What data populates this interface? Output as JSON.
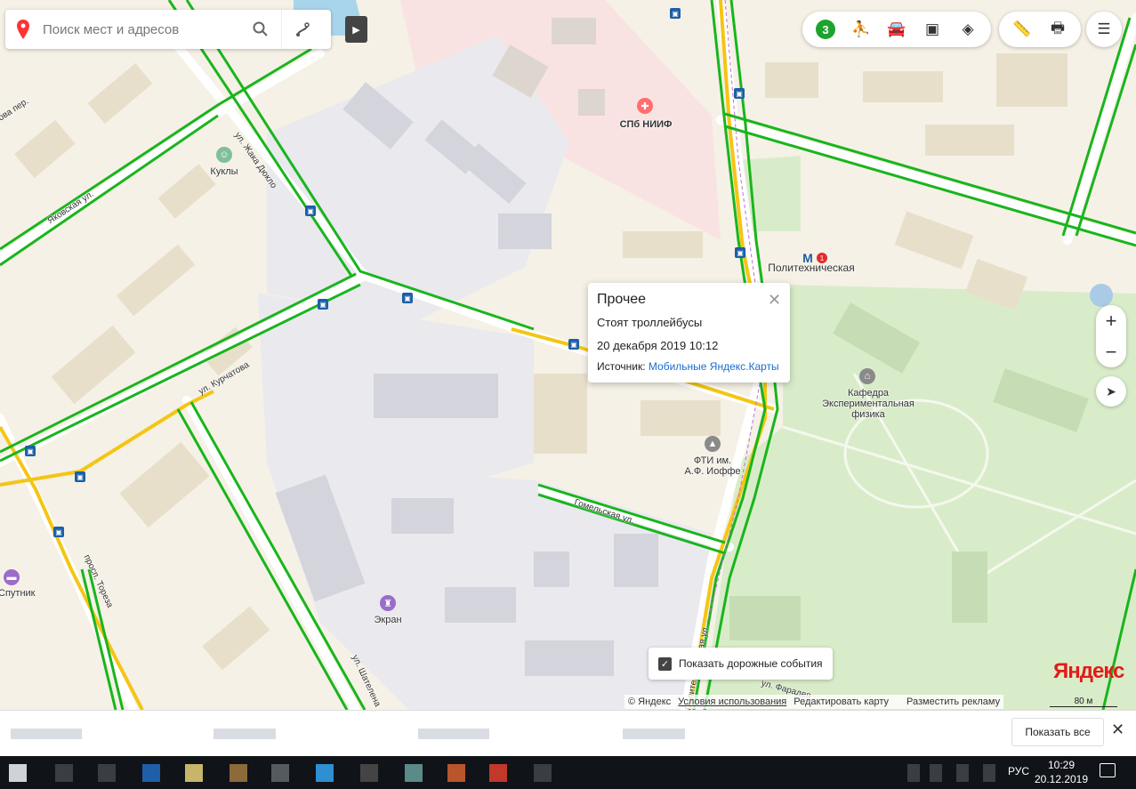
{
  "search": {
    "placeholder": "Поиск мест и адресов"
  },
  "toolbar": {
    "traffic_level": "3"
  },
  "map_labels": {
    "hospital": "СПб НИИФ",
    "metro": "Политехническая",
    "metro_badge": "1",
    "kukly": "Куклы",
    "ekran": "Экран",
    "sputnik": "Спутник",
    "fti": "ФТИ им.\nА.Ф. Иоффе",
    "kafedra": "Кафедра\nЭкспериментальная\nфизика",
    "street_zhaka": "ул. Жака Дюкло",
    "street_yakovskaya": "Яковская ул.",
    "street_kurchatova": "ул. Курчатова",
    "street_gomelskaya": "Гомельская ул.",
    "street_toreza": "просп. Тореза",
    "street_shateleна": "ул. Шателена",
    "street_politekh": "Политехническая ул.",
    "street_faraday": "ул. Фарадея",
    "street_per": "ова пер."
  },
  "popup": {
    "title": "Прочее",
    "line1": "Стоят троллейбусы",
    "line2": "20 декабря 2019 10:12",
    "source_label": "Источник:",
    "source_link": "Мобильные Яндекс.Карты"
  },
  "events": {
    "label": "Показать дорожные события",
    "checked": true
  },
  "logo": {
    "text": "Яндекс"
  },
  "scale": {
    "label": "80 м"
  },
  "footer": {
    "copyright": "© Яндекс",
    "terms": "Условия использования",
    "edit": "Редактировать карту",
    "ads": "Разместить рекламу"
  },
  "bottom_bar": {
    "show_all": "Показать все"
  },
  "taskbar": {
    "lang": "РУС",
    "time": "10:29",
    "date": "20.12.2019"
  }
}
